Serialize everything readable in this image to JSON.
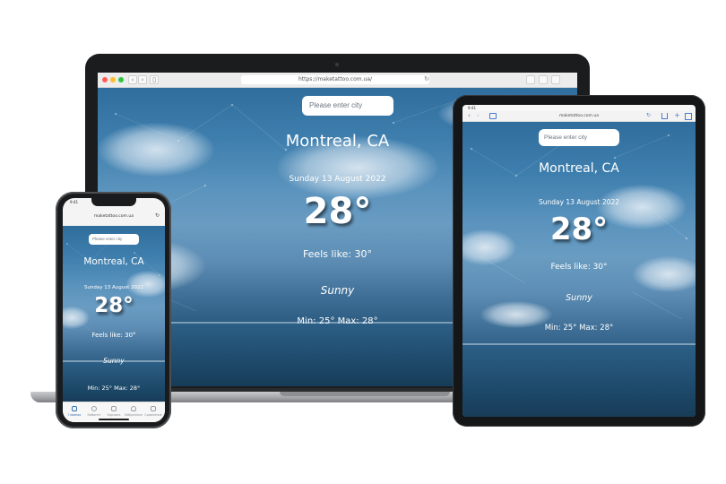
{
  "laptop": {
    "url": "https://maketattoo.com.ua/",
    "toolbar": {
      "back": "‹",
      "forward": "›",
      "sidebar": "▯",
      "reload": "↻"
    }
  },
  "tablet": {
    "status_time": "9:41",
    "url": "maketattoo.com.ua"
  },
  "phone": {
    "status_time": "9:41",
    "url": "maketattoo.com.ua",
    "tabs": [
      {
        "label": "Главная",
        "icon": "home-icon",
        "active": true
      },
      {
        "label": "Кабинет",
        "icon": "profile-icon",
        "active": false
      },
      {
        "label": "Карзина",
        "icon": "cart-icon",
        "active": false
      },
      {
        "label": "Избранные",
        "icon": "heart-icon",
        "active": false
      },
      {
        "label": "Сравнение",
        "icon": "compare-icon",
        "active": false
      }
    ]
  },
  "weather": {
    "search_placeholder": "Please enter city",
    "city": "Montreal, CA",
    "date": "Sunday 13 August 2022",
    "temperature": "28°",
    "feels_like": "Feels like: 30°",
    "condition": "Sunny",
    "min_max": "Min: 25° Max: 28°"
  },
  "colors": {
    "sky_top": "#2f6d9c",
    "sea": "#1e4a6b",
    "device_frame": "#1b1c1e",
    "active_tab": "#3a6fb0"
  }
}
